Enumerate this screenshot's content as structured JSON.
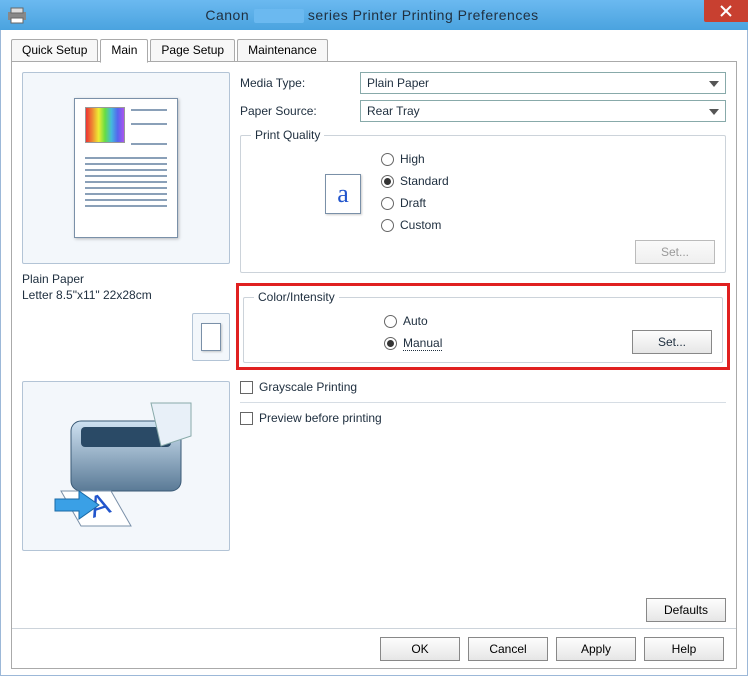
{
  "window": {
    "title_prefix": "Canon",
    "title_suffix": "series Printer Printing Preferences"
  },
  "tabs": [
    "Quick Setup",
    "Main",
    "Page Setup",
    "Maintenance"
  ],
  "active_tab": 1,
  "left": {
    "media_label": "Plain Paper",
    "size_label": "Letter 8.5\"x11\" 22x28cm"
  },
  "main": {
    "media_type": {
      "label": "Media Type:",
      "value": "Plain Paper"
    },
    "paper_source": {
      "label": "Paper Source:",
      "value": "Rear Tray"
    },
    "print_quality": {
      "legend": "Print Quality",
      "options": [
        "High",
        "Standard",
        "Draft",
        "Custom"
      ],
      "selected": 1,
      "set_button": "Set..."
    },
    "color_intensity": {
      "legend": "Color/Intensity",
      "options": [
        "Auto",
        "Manual"
      ],
      "selected": 1,
      "set_button": "Set..."
    },
    "grayscale": "Grayscale Printing",
    "preview": "Preview before printing",
    "defaults": "Defaults"
  },
  "buttons": {
    "ok": "OK",
    "cancel": "Cancel",
    "apply": "Apply",
    "help": "Help"
  }
}
